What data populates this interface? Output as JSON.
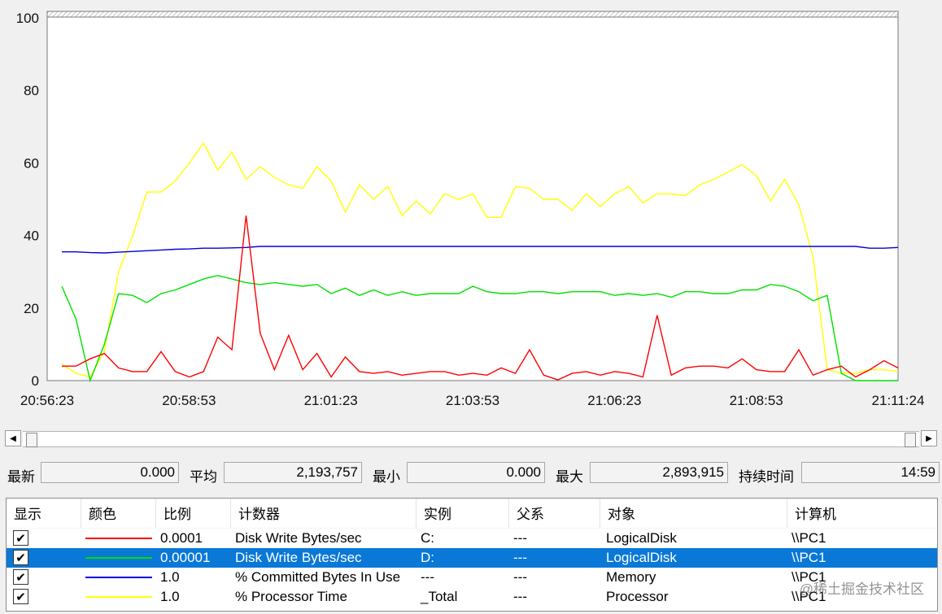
{
  "chart_data": {
    "type": "line",
    "ylim": [
      0,
      100
    ],
    "yticks": [
      "0",
      "20",
      "40",
      "60",
      "80",
      "100"
    ],
    "xtick_labels": [
      "20:56:23",
      "20:58:53",
      "21:01:23",
      "21:03:53",
      "21:06:23",
      "21:08:53",
      "21:11:24"
    ],
    "x_start": "20:56:23",
    "x_end": "21:11:24",
    "grid": false,
    "series": [
      {
        "key": "disk_c",
        "color": "#ff0000",
        "values": [
          4,
          4,
          6,
          7.5,
          3.5,
          2.5,
          2.5,
          8,
          2.5,
          1,
          2.5,
          12,
          8.5,
          45.5,
          13,
          3,
          12.5,
          3,
          7.5,
          1,
          6.5,
          2.5,
          2,
          2.5,
          1.5,
          2,
          2.5,
          2.5,
          1.5,
          2,
          1.5,
          3.5,
          2,
          8.5,
          1.5,
          0.2,
          2,
          2.5,
          1.5,
          2.5,
          2,
          1,
          18,
          1.5,
          3.5,
          4,
          4,
          3.5,
          6,
          3,
          2.5,
          2.5,
          8.5,
          1.5,
          3,
          4,
          1,
          3,
          5.5,
          3.5
        ]
      },
      {
        "key": "disk_d",
        "color": "#00e000",
        "values": [
          26,
          17,
          0,
          10,
          24,
          23.5,
          21.5,
          24,
          25,
          26.5,
          28,
          29,
          28,
          27,
          26.5,
          27,
          26.5,
          26,
          26.5,
          24,
          25.5,
          23.5,
          25,
          23.5,
          24.5,
          23.5,
          24,
          24,
          24,
          26,
          24.5,
          24,
          24,
          24.5,
          24.5,
          24,
          24.5,
          24.5,
          24.5,
          23.5,
          24,
          23.5,
          24,
          23,
          24.5,
          24.5,
          24,
          24,
          25,
          25,
          26.5,
          26,
          24.5,
          22,
          23.5,
          2,
          0,
          0,
          0,
          0
        ]
      },
      {
        "key": "committed",
        "color": "#0000e0",
        "values": [
          35.5,
          35.5,
          35.3,
          35.2,
          35.4,
          35.6,
          35.8,
          36,
          36.2,
          36.3,
          36.5,
          36.5,
          36.6,
          36.7,
          37,
          37,
          37,
          37,
          37,
          37,
          37,
          37,
          37,
          37,
          37,
          37,
          37,
          37,
          37,
          37,
          37,
          37,
          37,
          37,
          37,
          37,
          37,
          37,
          37,
          37,
          37,
          37,
          37,
          37,
          37,
          37,
          37,
          37,
          37,
          37,
          37,
          37,
          37,
          37,
          37,
          37,
          37,
          36.5,
          36.5,
          36.7
        ]
      },
      {
        "key": "processor",
        "color": "#ffff00",
        "values": [
          4.5,
          2,
          1,
          8,
          30,
          40,
          52,
          52,
          55,
          60,
          65.5,
          58,
          63,
          55.5,
          59,
          56,
          54,
          53,
          59,
          55,
          46.5,
          54,
          50,
          53.5,
          45.5,
          49.5,
          46,
          51.5,
          50,
          51.5,
          45,
          45,
          53.5,
          53,
          50,
          50,
          47,
          51.5,
          48,
          51.5,
          53.5,
          49,
          51.5,
          51.5,
          51,
          54,
          55.5,
          57.5,
          59.5,
          56.5,
          49.5,
          55.5,
          48.5,
          34,
          3,
          2,
          2,
          3,
          3,
          2.5
        ]
      }
    ]
  },
  "scrollbar": {
    "left_icon": "arrow-left-icon",
    "right_icon": "arrow-right-icon",
    "left_glyph": "◀",
    "right_glyph": "▶"
  },
  "stats": {
    "latest_label": "最新",
    "latest_value": "0.000",
    "average_label": "平均",
    "average_value": "2,193,757",
    "min_label": "最小",
    "min_value": "0.000",
    "max_label": "最大",
    "max_value": "2,893,915",
    "duration_label": "持续时间",
    "duration_value": "14:59"
  },
  "legend": {
    "headers": [
      "显示",
      "颜色",
      "比例",
      "计数器",
      "实例",
      "父系",
      "对象",
      "计算机"
    ],
    "rows": [
      {
        "checked": "✔",
        "color": "#ff0000",
        "scale": "0.0001",
        "counter": "Disk Write Bytes/sec",
        "instance": "C:",
        "parent": "---",
        "object": "LogicalDisk",
        "computer": "\\\\PC1"
      },
      {
        "checked": "✔",
        "color": "#00e000",
        "scale": "0.00001",
        "counter": "Disk Write Bytes/sec",
        "instance": "D:",
        "parent": "---",
        "object": "LogicalDisk",
        "computer": "\\\\PC1"
      },
      {
        "checked": "✔",
        "color": "#0000e0",
        "scale": "1.0",
        "counter": "% Committed Bytes In Use",
        "instance": "---",
        "parent": "---",
        "object": "Memory",
        "computer": "\\\\PC1"
      },
      {
        "checked": "✔",
        "color": "#ffff00",
        "scale": "1.0",
        "counter": "% Processor Time",
        "instance": "_Total",
        "parent": "---",
        "object": "Processor",
        "computer": "\\\\PC1"
      }
    ]
  },
  "watermark": "@稀土掘金技术社区"
}
